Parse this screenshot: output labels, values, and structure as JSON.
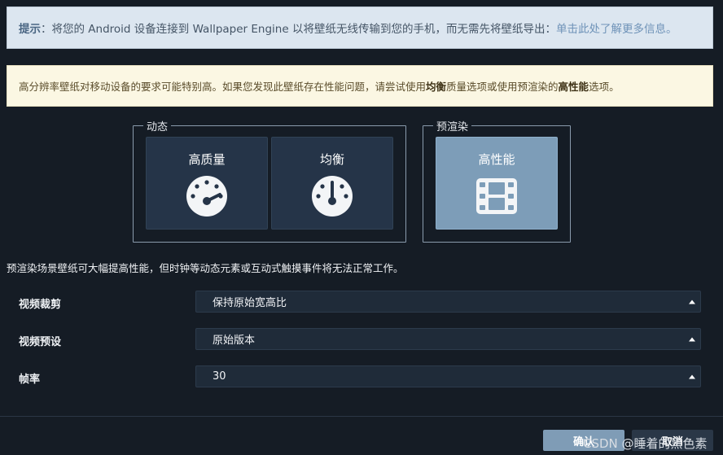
{
  "info": {
    "label": "提示",
    "text": "：将您的 Android 设备连接到 Wallpaper Engine 以将壁纸无线传输到您的手机，而无需先将壁纸导出：",
    "link": "单击此处了解更多信息。"
  },
  "warning": {
    "part1": "高分辨率壁纸对移动设备的要求可能特别高。如果您发现此壁纸存在性能问题，请尝试使用",
    "bold1": "均衡",
    "part2": "质量选项或使用预渲染的",
    "bold2": "高性能",
    "part3": "选项。"
  },
  "groups": {
    "dynamic": {
      "title": "动态",
      "options": [
        {
          "label": "高质量",
          "icon": "gauge-high-icon"
        },
        {
          "label": "均衡",
          "icon": "gauge-balanced-icon"
        }
      ]
    },
    "prerender": {
      "title": "预渲染",
      "options": [
        {
          "label": "高性能",
          "icon": "film-icon",
          "selected": true
        }
      ]
    }
  },
  "note": "预渲染场景壁纸可大幅提高性能，但时钟等动态元素或互动式触摸事件将无法正常工作。",
  "settings": [
    {
      "label": "视频裁剪",
      "value": "保持原始宽高比"
    },
    {
      "label": "视频预设",
      "value": "原始版本"
    },
    {
      "label": "帧率",
      "value": "30"
    }
  ],
  "buttons": {
    "ok": "确认",
    "cancel": "取消"
  },
  "watermark": "CSDN @睡着的黑色素",
  "colors": {
    "background": "#151c25",
    "tile": "#253448",
    "tile_selected": "#7d9db8",
    "ok_button": "#7f9cb6"
  }
}
